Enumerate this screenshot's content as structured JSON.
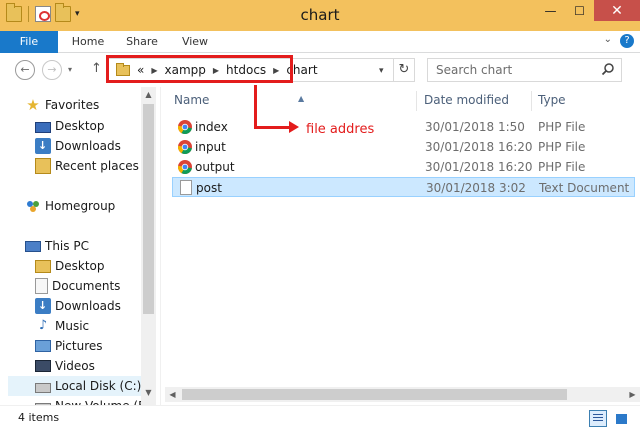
{
  "window": {
    "title": "chart"
  },
  "window_buttons": {
    "minimize": "—",
    "maximize": "☐",
    "close": "✕"
  },
  "ribbon": {
    "tabs": [
      {
        "label": "File",
        "active": true
      },
      {
        "label": "Home"
      },
      {
        "label": "Share"
      },
      {
        "label": "View"
      }
    ],
    "expand_glyph": "⌄",
    "help_glyph": "?"
  },
  "navigation": {
    "back_glyph": "←",
    "forward_glyph": "→",
    "history_glyph": "▾",
    "up_glyph": "↑"
  },
  "address": {
    "overflow": "«",
    "crumbs": [
      "xampp",
      "htdocs",
      "chart"
    ],
    "separator": "▶",
    "dropdown_glyph": "▾",
    "refresh_glyph": "↻"
  },
  "search": {
    "placeholder": "Search chart"
  },
  "nav_pane": {
    "favorites": "Favorites",
    "favorites_items": [
      "Desktop",
      "Downloads",
      "Recent places"
    ],
    "homegroup": "Homegroup",
    "this_pc": "This PC",
    "pc_items": [
      "Desktop",
      "Documents",
      "Downloads",
      "Music",
      "Pictures",
      "Videos",
      "Local Disk (C:)",
      "New Volume (E:)"
    ]
  },
  "file_list": {
    "columns": {
      "name": "Name",
      "date": "Date modified",
      "type": "Type"
    },
    "sort_glyph": "▲",
    "rows": [
      {
        "name": "index",
        "date": "30/01/2018 1:50",
        "type": "PHP File",
        "icon": "chrome-icon"
      },
      {
        "name": "input",
        "date": "30/01/2018 16:20",
        "type": "PHP File",
        "icon": "chrome-icon"
      },
      {
        "name": "output",
        "date": "30/01/2018 16:20",
        "type": "PHP File",
        "icon": "chrome-icon"
      },
      {
        "name": "post",
        "date": "30/01/2018 3:02",
        "type": "Text Document",
        "icon": "text-file-icon",
        "selected": true
      }
    ]
  },
  "status": {
    "count": "4 items"
  },
  "annotation": {
    "text": "file addres",
    "color": "#e31c1c"
  },
  "colors": {
    "accent": "#1979ca",
    "title_bar": "#f3c15d",
    "selection": "#cce8ff",
    "annotation": "#e31c1c"
  }
}
